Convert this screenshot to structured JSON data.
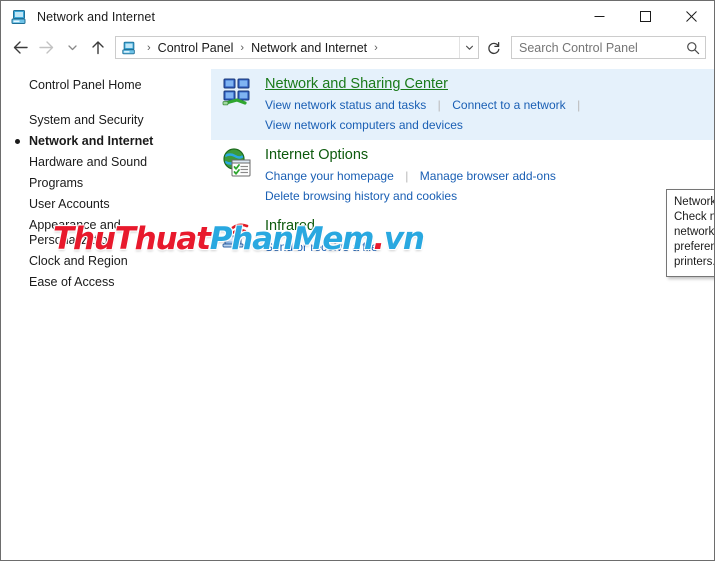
{
  "window": {
    "title": "Network and Internet",
    "title_icon": "network-computer-icon",
    "minimize_label": "Minimize",
    "maximize_label": "Maximize",
    "close_label": "Close"
  },
  "addressbar": {
    "back_label": "Back",
    "forward_label": "Forward",
    "recent_label": "Recent locations",
    "up_label": "Up one level",
    "path_icon": "network-computer-icon",
    "crumbs": [
      "Control Panel",
      "Network and Internet"
    ],
    "separator": "›",
    "dropdown_label": "Previous locations",
    "refresh_label": "Refresh",
    "search": {
      "placeholder": "Search Control Panel",
      "value": "",
      "icon": "search-icon"
    }
  },
  "sidebar": {
    "home": "Control Panel Home",
    "items": [
      {
        "label": "System and Security",
        "current": false
      },
      {
        "label": "Network and Internet",
        "current": true
      },
      {
        "label": "Hardware and Sound",
        "current": false
      },
      {
        "label": "Programs",
        "current": false
      },
      {
        "label": "User Accounts",
        "current": false
      },
      {
        "label": "Appearance and\nPersonalization",
        "current": false
      },
      {
        "label": "Clock and Region",
        "current": false
      },
      {
        "label": "Ease of Access",
        "current": false
      }
    ]
  },
  "main": {
    "categories": [
      {
        "icon": "network-sharing-center-icon",
        "title": "Network and Sharing Center",
        "hovered": true,
        "links_row1": [
          "View network status and tasks",
          "Connect to a network"
        ],
        "links_row2": [
          "View network computers and devices"
        ]
      },
      {
        "icon": "internet-options-icon",
        "title": "Internet Options",
        "hovered": false,
        "links_row1": [
          "Change your homepage",
          "Manage browser add-ons"
        ],
        "links_row2": [
          "Delete browsing history and cookies"
        ]
      },
      {
        "icon": "infrared-icon",
        "title": "Infrared",
        "hovered": false,
        "links_row1": [
          "Send or receive a file"
        ],
        "links_row2": []
      }
    ]
  },
  "tooltip": {
    "title": "Network and Sharing Center",
    "body": "Check network status, change network settings and set preferences for sharing files and printers."
  },
  "watermark": {
    "part1": "Thu",
    "part2": "Thuat",
    "part3": "Phan",
    "part4": "Mem",
    "part5": ".",
    "part6": "vn",
    "color_red": "#e8192c",
    "color_blue": "#29a8e0"
  }
}
